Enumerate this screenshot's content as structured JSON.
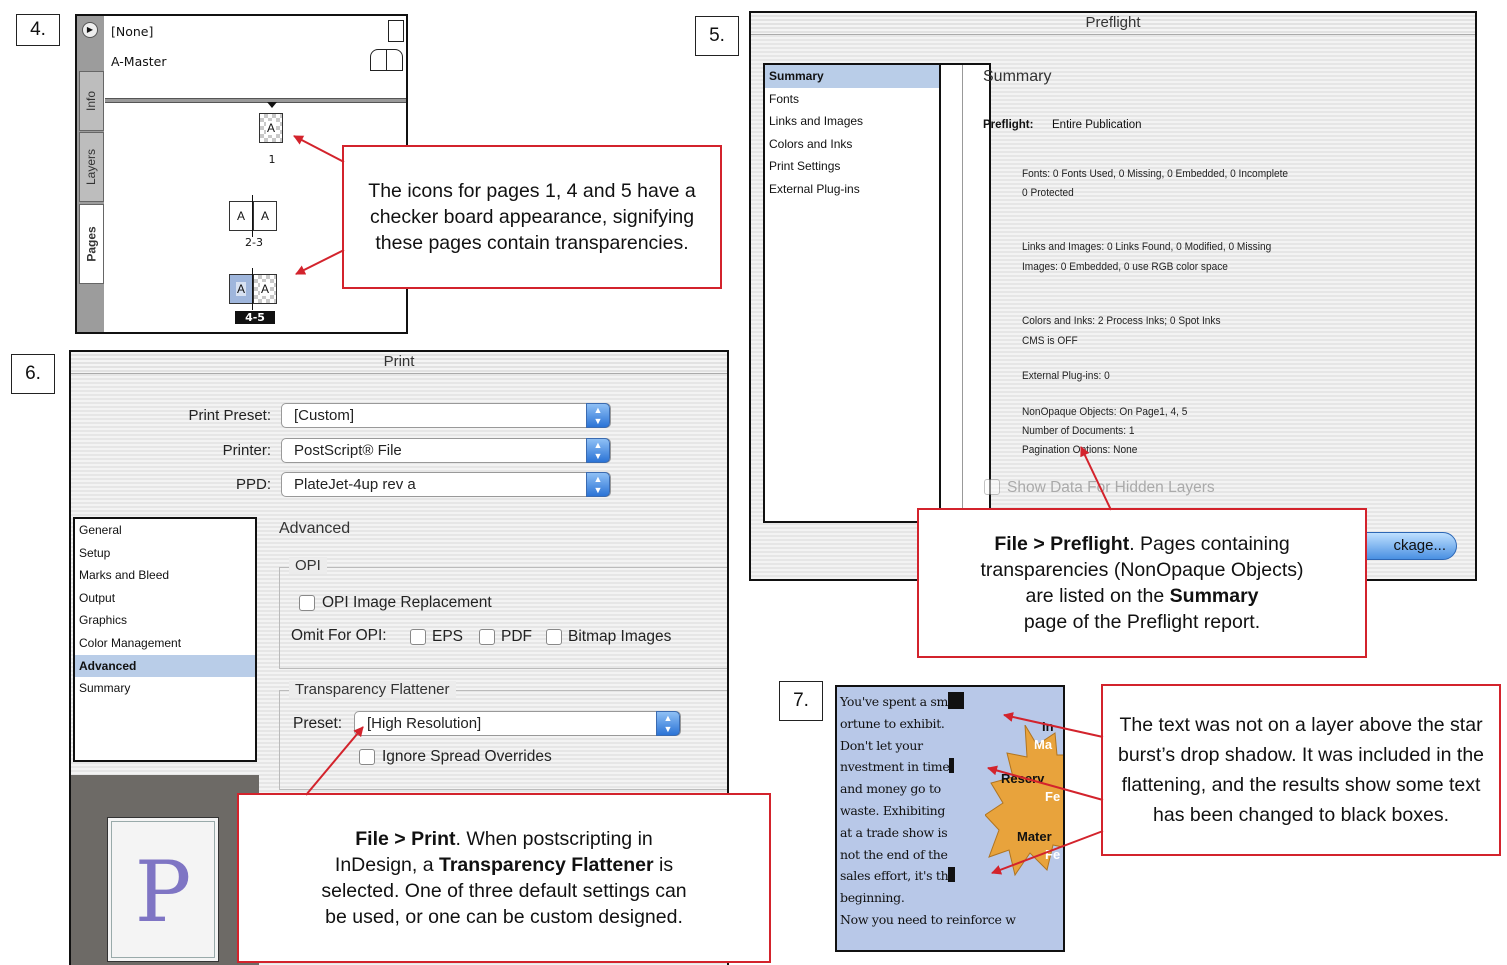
{
  "steps": {
    "s4": "4.",
    "s5": "5.",
    "s6": "6.",
    "s7": "7."
  },
  "pages_panel": {
    "masters": [
      "[None]",
      "A-Master"
    ],
    "tabs": [
      "Info",
      "Layers",
      "Pages"
    ],
    "pages": [
      {
        "letters": [
          "A"
        ],
        "label": "1"
      },
      {
        "letters": [
          "A",
          "A"
        ],
        "label": "2-3"
      },
      {
        "letters": [
          "A",
          "A"
        ],
        "label": "4-5"
      }
    ],
    "callout": "The icons for pages 1, 4 and 5 have a checker board appearance, signifying these pages contain transparencies."
  },
  "preflight": {
    "title": "Preflight",
    "sidebar": [
      "Summary",
      "Fonts",
      "Links and Images",
      "Colors and Inks",
      "Print Settings",
      "External Plug-ins"
    ],
    "heading": "Summary",
    "scope_label": "Preflight:",
    "scope_value": "Entire Publication",
    "lines": [
      "Fonts: 0 Fonts Used, 0 Missing, 0 Embedded, 0 Incomplete",
      "0 Protected",
      "Links and Images: 0 Links Found, 0 Modified, 0 Missing",
      "Images: 0 Embedded, 0 use RGB color space",
      "Colors and Inks: 2 Process Inks; 0 Spot Inks",
      "CMS is OFF",
      "External Plug-ins: 0",
      "NonOpaque Objects: On Page1, 4, 5",
      "Number of Documents: 1",
      "Pagination Options: None"
    ],
    "hidden_layers_label": "Show Data For Hidden Layers",
    "package_button": "ckage...",
    "callout_lines": [
      {
        "bold": "File > Preflight",
        "rest": ". Pages containing"
      },
      {
        "text": "transparencies (NonOpaque Objects)"
      },
      {
        "pre": "are listed on the ",
        "bold": "Summary"
      },
      {
        "text": "page of the Preflight report."
      }
    ]
  },
  "print": {
    "title": "Print",
    "preset_label": "Print Preset:",
    "preset_value": "[Custom]",
    "printer_label": "Printer:",
    "printer_value": "PostScript® File",
    "ppd_label": "PPD:",
    "ppd_value": "PlateJet-4up rev a",
    "sidebar": [
      "General",
      "Setup",
      "Marks and Bleed",
      "Output",
      "Graphics",
      "Color Management",
      "Advanced",
      "Summary"
    ],
    "section_title": "Advanced",
    "opi_group": "OPI",
    "opi_replacement": "OPI Image Replacement",
    "omit_label": "Omit For OPI:",
    "omit_options": [
      "EPS",
      "PDF",
      "Bitmap Images"
    ],
    "flattener_group": "Transparency Flattener",
    "flattener_preset_label": "Preset:",
    "flattener_preset_value": "[High Resolution]",
    "ignore_overrides": "Ignore Spread Overrides",
    "preview_letter": "P",
    "callout_lines": [
      {
        "bold": "File > Print",
        "rest": ". When postscripting in"
      },
      {
        "pre": "InDesign, a ",
        "bold": "Transparency Flattener",
        "rest": " is"
      },
      {
        "text": "selected. One of three default settings can"
      },
      {
        "text": "be used, or one can be custom designed."
      }
    ]
  },
  "flatten_sample": {
    "lines": [
      "You've spent a sm",
      "ortune to exhibit.",
      "Don't let your",
      "nvestment in time",
      "and money go to",
      "waste. Exhibiting",
      "at a trade show is",
      "not the end of the",
      "sales effort, it's th",
      "beginning.",
      "Now you need to reinforce w"
    ],
    "burst_words": [
      "In",
      "Ma",
      "Reserv",
      "Fe",
      "Mater",
      "Fe"
    ],
    "callout": "The text was not on a layer above the star burst’s drop shadow. It was included in the flattening, and the results show some text has been changed to black boxes."
  },
  "colors": {
    "callout_border": "#d3232c",
    "selection": "#b9cde8",
    "sample_bg": "#b8c8e8",
    "burst": "#e8a33c"
  }
}
